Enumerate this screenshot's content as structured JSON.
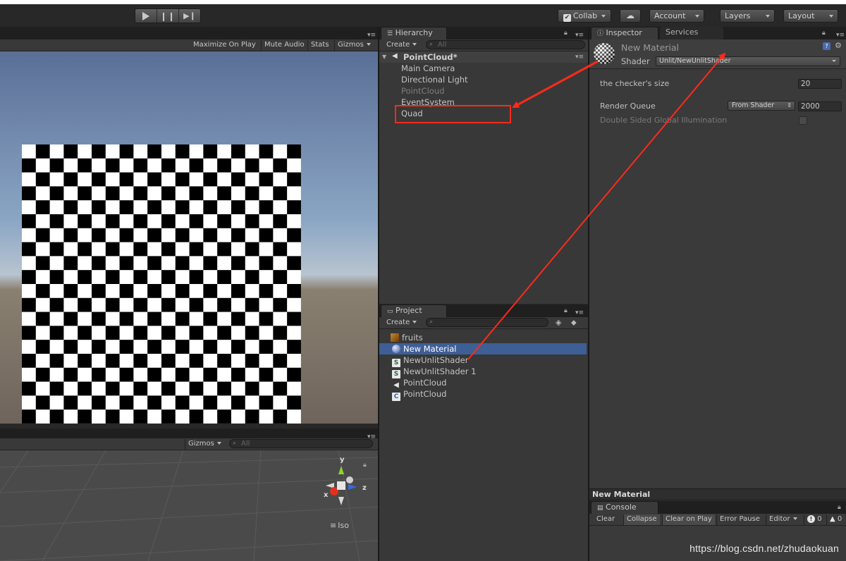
{
  "toolbar": {
    "collab_label": "Collab",
    "account_label": "Account",
    "layers_label": "Layers",
    "layout_label": "Layout"
  },
  "game_view": {
    "maximize_label": "Maximize On Play",
    "mute_label": "Mute Audio",
    "stats_label": "Stats",
    "gizmos_label": "Gizmos"
  },
  "scene_view": {
    "gizmos_label": "Gizmos",
    "search_placeholder": "All",
    "axis_y": "y",
    "axis_z": "z",
    "axis_x": "x",
    "projection_label": "Iso"
  },
  "hierarchy": {
    "tab_label": "Hierarchy",
    "create_label": "Create",
    "search_placeholder": "All",
    "scene_name": "PointCloud*",
    "items": [
      {
        "label": "Main Camera",
        "state": "normal"
      },
      {
        "label": "Directional Light",
        "state": "normal"
      },
      {
        "label": "PointCloud",
        "state": "dim"
      },
      {
        "label": "EventSystem",
        "state": "normal"
      },
      {
        "label": "Quad",
        "state": "normal"
      }
    ]
  },
  "project": {
    "tab_label": "Project",
    "create_label": "Create",
    "items": [
      {
        "label": "fruits",
        "icon": "image-icon"
      },
      {
        "label": "New Material",
        "icon": "material-icon",
        "selected": true
      },
      {
        "label": "NewUnlitShader",
        "icon": "shader-icon"
      },
      {
        "label": "NewUnlitShader 1",
        "icon": "shader-icon"
      },
      {
        "label": "PointCloud",
        "icon": "unity-scene-icon"
      },
      {
        "label": "PointCloud",
        "icon": "csharp-script-icon"
      }
    ]
  },
  "inspector": {
    "tab_label": "Inspector",
    "services_tab_label": "Services",
    "material_name": "New Material",
    "shader_label": "Shader",
    "shader_value": "Unlit/NewUnlitShader",
    "checker_size_label": "the checker's size",
    "checker_size_value": "20",
    "render_queue_label": "Render Queue",
    "render_queue_mode": "From Shader",
    "render_queue_value": "2000",
    "double_sided_label": "Double Sided Global Illumination",
    "preview_title": "New Material"
  },
  "console": {
    "tab_label": "Console",
    "clear_label": "Clear",
    "collapse_label": "Collapse",
    "clear_on_play_label": "Clear on Play",
    "error_pause_label": "Error Pause",
    "editor_label": "Editor",
    "info_count": "0",
    "warn_count": "0"
  },
  "watermark": "https://blog.csdn.net/zhudaokuan",
  "annotation_color": "#ff2a1a"
}
